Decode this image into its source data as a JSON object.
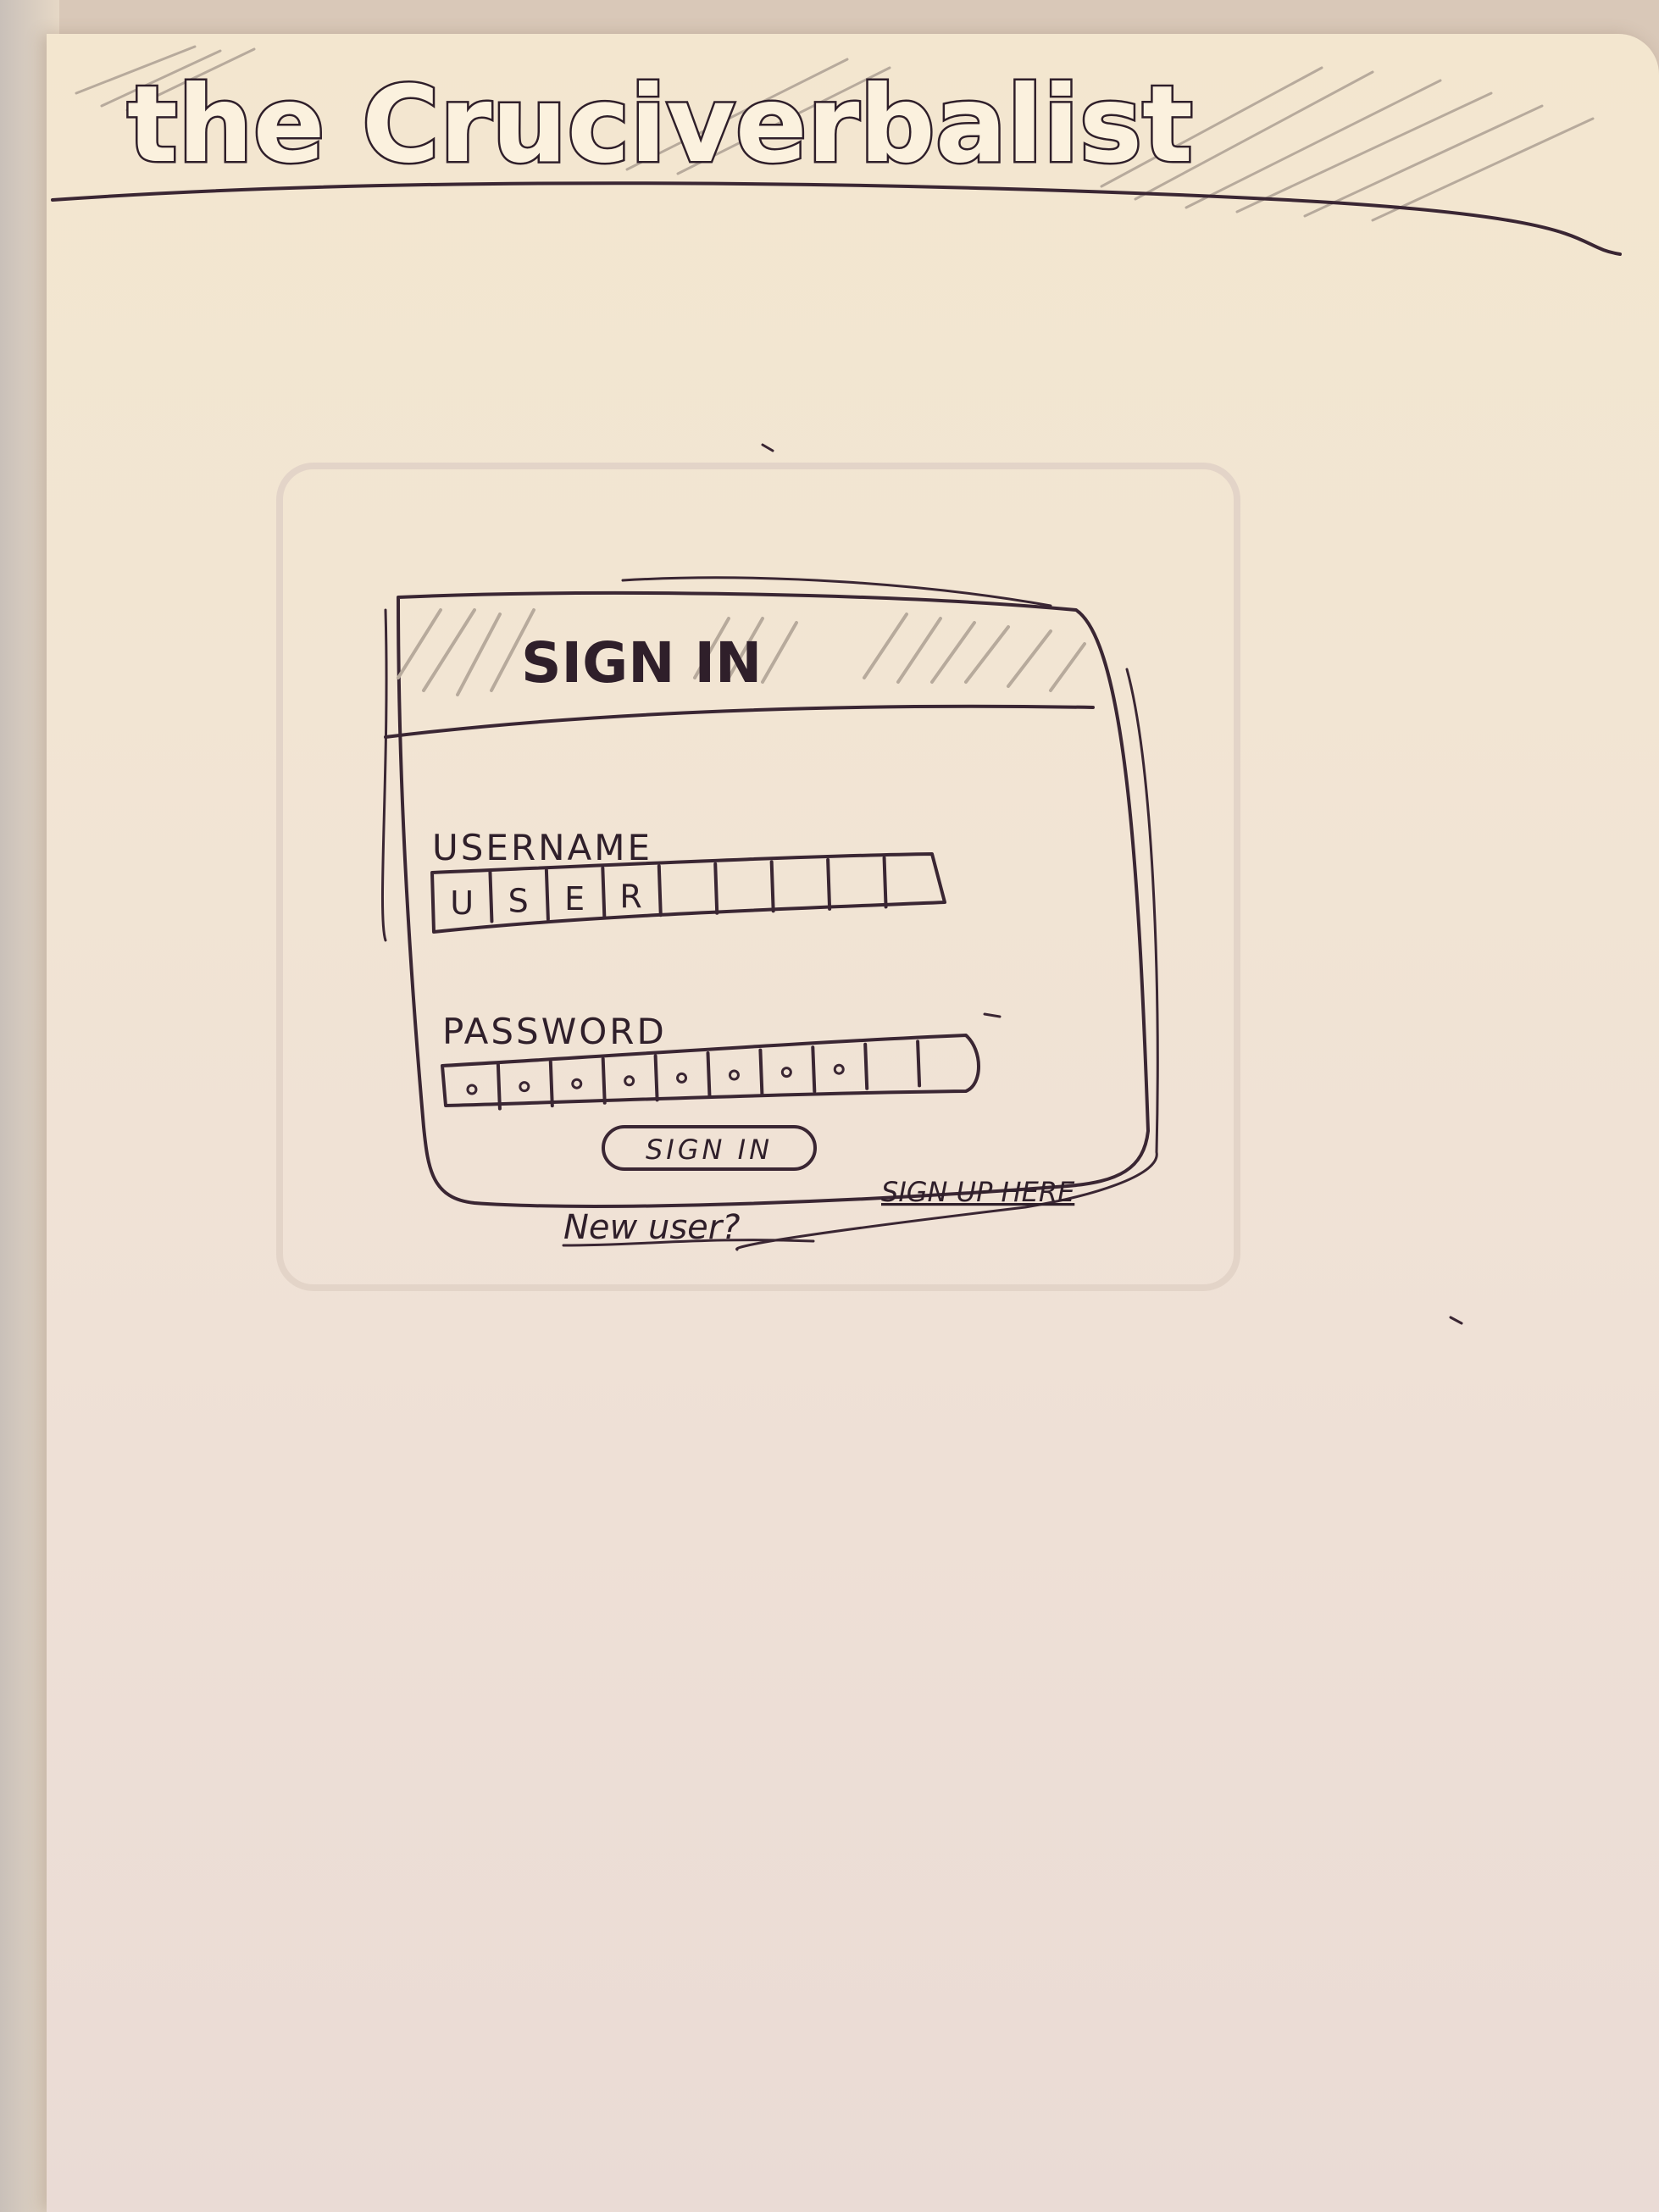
{
  "header": {
    "logo_text": "the Cruciverbalist"
  },
  "signin_panel": {
    "title": "SIGN IN",
    "username_label": "USERNAME",
    "username_chars": [
      "U",
      "S",
      "E",
      "R",
      "",
      "",
      "",
      "",
      ""
    ],
    "password_label": "PASSWORD",
    "password_mask_count": 8,
    "signin_button_label": "SIGN IN",
    "new_user_text": "New user?",
    "signup_link_text": "SIGN UP HERE"
  },
  "colors": {
    "paper": "#f2e5d3",
    "ink": "#2f1f2a",
    "pencil": "#b7aa9c"
  }
}
